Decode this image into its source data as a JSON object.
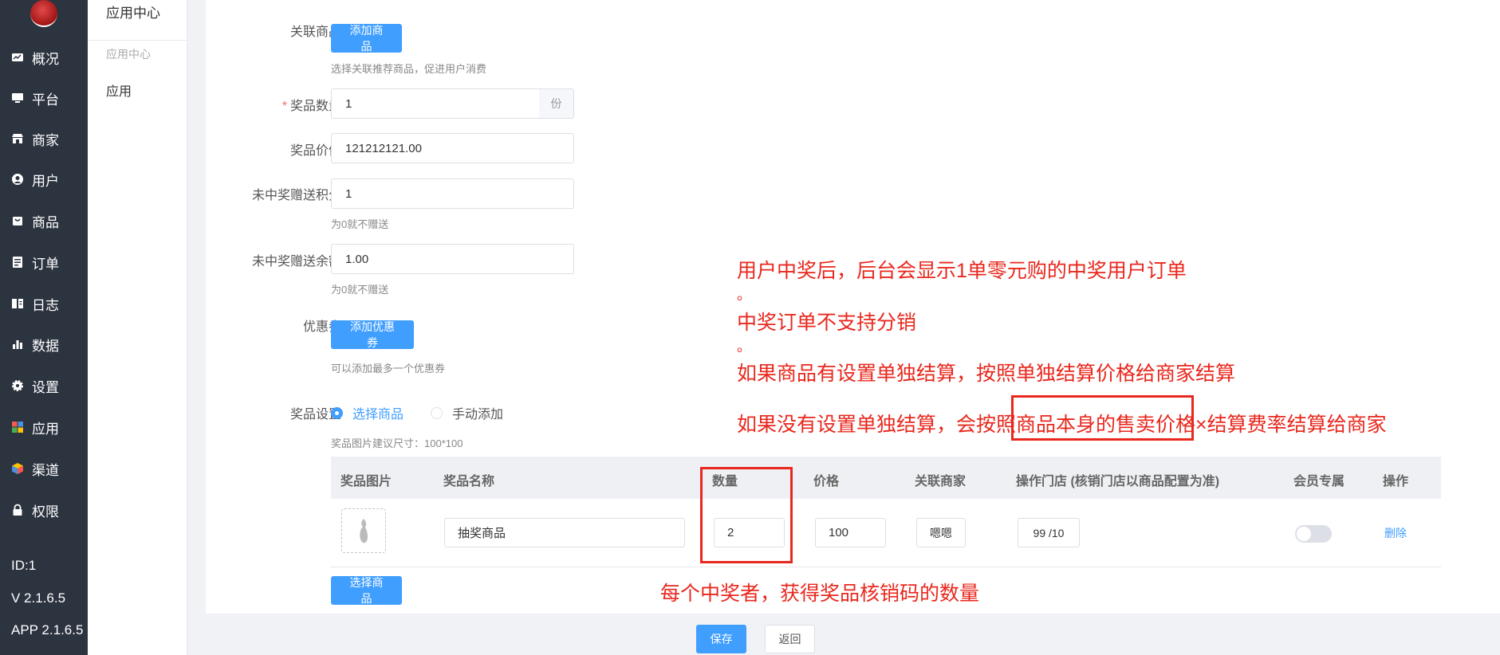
{
  "sidebar": {
    "items": [
      {
        "label": "概况",
        "icon": "dashboard-icon"
      },
      {
        "label": "平台",
        "icon": "monitor-icon"
      },
      {
        "label": "商家",
        "icon": "store-icon"
      },
      {
        "label": "用户",
        "icon": "user-icon"
      },
      {
        "label": "商品",
        "icon": "bag-icon"
      },
      {
        "label": "订单",
        "icon": "order-icon"
      },
      {
        "label": "日志",
        "icon": "log-icon"
      },
      {
        "label": "数据",
        "icon": "chart-icon"
      },
      {
        "label": "设置",
        "icon": "gear-icon"
      },
      {
        "label": "应用",
        "icon": "apps-icon"
      },
      {
        "label": "渠道",
        "icon": "cube-icon"
      },
      {
        "label": "权限",
        "icon": "lock-icon"
      }
    ],
    "meta": [
      "ID:1",
      "V 2.1.6.5",
      "APP 2.1.6.5"
    ]
  },
  "submenu": {
    "title": "应用中心",
    "group": "应用中心",
    "item": "应用"
  },
  "form": {
    "related_goods": {
      "label": "关联商品",
      "button": "添加商品",
      "hint": "选择关联推荐商品，促进用户消费"
    },
    "prize_count": {
      "label": "奖品数量",
      "value": "1",
      "suffix": "份"
    },
    "prize_value": {
      "label": "奖品价值",
      "value": "121212121.00"
    },
    "consolation_points": {
      "label": "未中奖赠送积分",
      "value": "1",
      "hint": "为0就不赠送"
    },
    "consolation_balance": {
      "label": "未中奖赠送余额",
      "value": "1.00",
      "hint": "为0就不赠送"
    },
    "coupon": {
      "label": "优惠券",
      "button": "添加优惠券",
      "hint": "可以添加最多一个优惠券"
    },
    "prize_settings": {
      "label": "奖品设置",
      "options": [
        "选择商品",
        "手动添加"
      ],
      "selected": "选择商品",
      "hint": "奖品图片建议尺寸：100*100"
    }
  },
  "table": {
    "headers": [
      "奖品图片",
      "奖品名称",
      "数量",
      "价格",
      "关联商家",
      "操作门店 (核销门店以商品配置为准)",
      "会员专属",
      "操作"
    ],
    "rows": [
      {
        "name": "抽奖商品",
        "quantity": "2",
        "price": "100",
        "merchant": "嗯嗯",
        "stores": "99 /10",
        "action": "删除"
      }
    ],
    "select_button": "选择商品"
  },
  "footer": {
    "save": "保存",
    "back": "返回"
  },
  "annotations": {
    "lines": [
      "用户中奖后，后台会显示1单零元购的中奖用户订单",
      "。",
      "中奖订单不支持分销",
      "。",
      "如果商品有设置单独结算，按照单独结算价格给商家结算",
      "如果没有设置单独结算，会按照商品本身的售卖价格×结算费率结算给商家"
    ],
    "quantity_note": "每个中奖者，获得奖品核销码的数量"
  },
  "colors": {
    "sidebar": "#2c3440",
    "primary": "#409eff",
    "annotation": "#e8281e"
  }
}
